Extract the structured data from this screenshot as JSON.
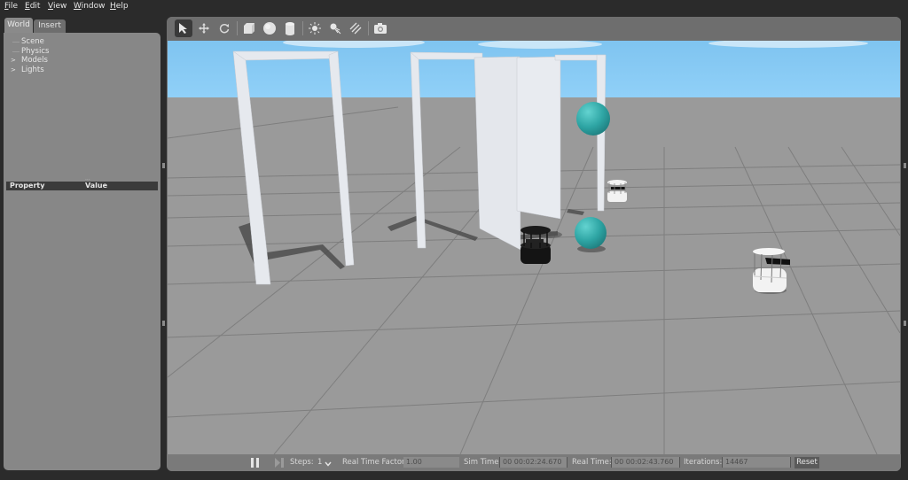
{
  "menu": {
    "items": [
      {
        "label": "File",
        "underline": "F",
        "rest": "ile"
      },
      {
        "label": "Edit",
        "underline": "E",
        "rest": "dit"
      },
      {
        "label": "View",
        "underline": "V",
        "rest": "iew"
      },
      {
        "label": "Window",
        "underline": "W",
        "rest": "indow"
      },
      {
        "label": "Help",
        "underline": "H",
        "rest": "elp"
      }
    ]
  },
  "left_panel": {
    "tabs": [
      {
        "label": "World",
        "active": true
      },
      {
        "label": "Insert",
        "active": false
      }
    ],
    "tree": [
      {
        "label": "Scene",
        "expandable": false
      },
      {
        "label": "Physics",
        "expandable": false
      },
      {
        "label": "Models",
        "expandable": true
      },
      {
        "label": "Lights",
        "expandable": true
      }
    ],
    "property_table": {
      "columns": [
        "Property",
        "Value"
      ]
    }
  },
  "toolbar": {
    "tools": [
      {
        "name": "select-mode",
        "icon": "arrow-cursor-icon",
        "selected": true
      },
      {
        "name": "translate-mode",
        "icon": "move-arrows-icon",
        "selected": false
      },
      {
        "name": "rotate-mode",
        "icon": "rotate-icon",
        "selected": false
      },
      {
        "name": "box",
        "icon": "box-icon",
        "selected": false
      },
      {
        "name": "sphere",
        "icon": "sphere-icon",
        "selected": false
      },
      {
        "name": "cylinder",
        "icon": "cylinder-icon",
        "selected": false
      },
      {
        "name": "point-light",
        "icon": "point-light-icon",
        "selected": false
      },
      {
        "name": "spot-light",
        "icon": "spot-light-icon",
        "selected": false
      },
      {
        "name": "directional-light",
        "icon": "directional-light-icon",
        "selected": false
      },
      {
        "name": "screenshot",
        "icon": "camera-icon",
        "selected": false
      }
    ]
  },
  "scene": {
    "sky_color": "#87c9f2",
    "ground_color": "#9b9b9b",
    "wall_color": "#e6e9ee",
    "sphere_color": "#2fa3a3",
    "objects": [
      "door-frame-left",
      "door-frame-middle",
      "wall-panel-1",
      "wall-panel-2",
      "door-frame-right",
      "sphere-upper",
      "sphere-lower",
      "robot-black",
      "robot-white-far",
      "robot-white-near"
    ]
  },
  "bottom_bar": {
    "steps_label": "Steps:",
    "steps_value": "1",
    "real_time_factor_label": "Real Time Factor:",
    "real_time_factor_value": "1.00",
    "sim_time_label": "Sim Time:",
    "sim_time_value": "00 00:02:24.670",
    "real_time_label": "Real Time:",
    "real_time_value": "00 00:02:43.760",
    "iterations_label": "Iterations:",
    "iterations_value": "14467",
    "reset_label": "Reset"
  }
}
